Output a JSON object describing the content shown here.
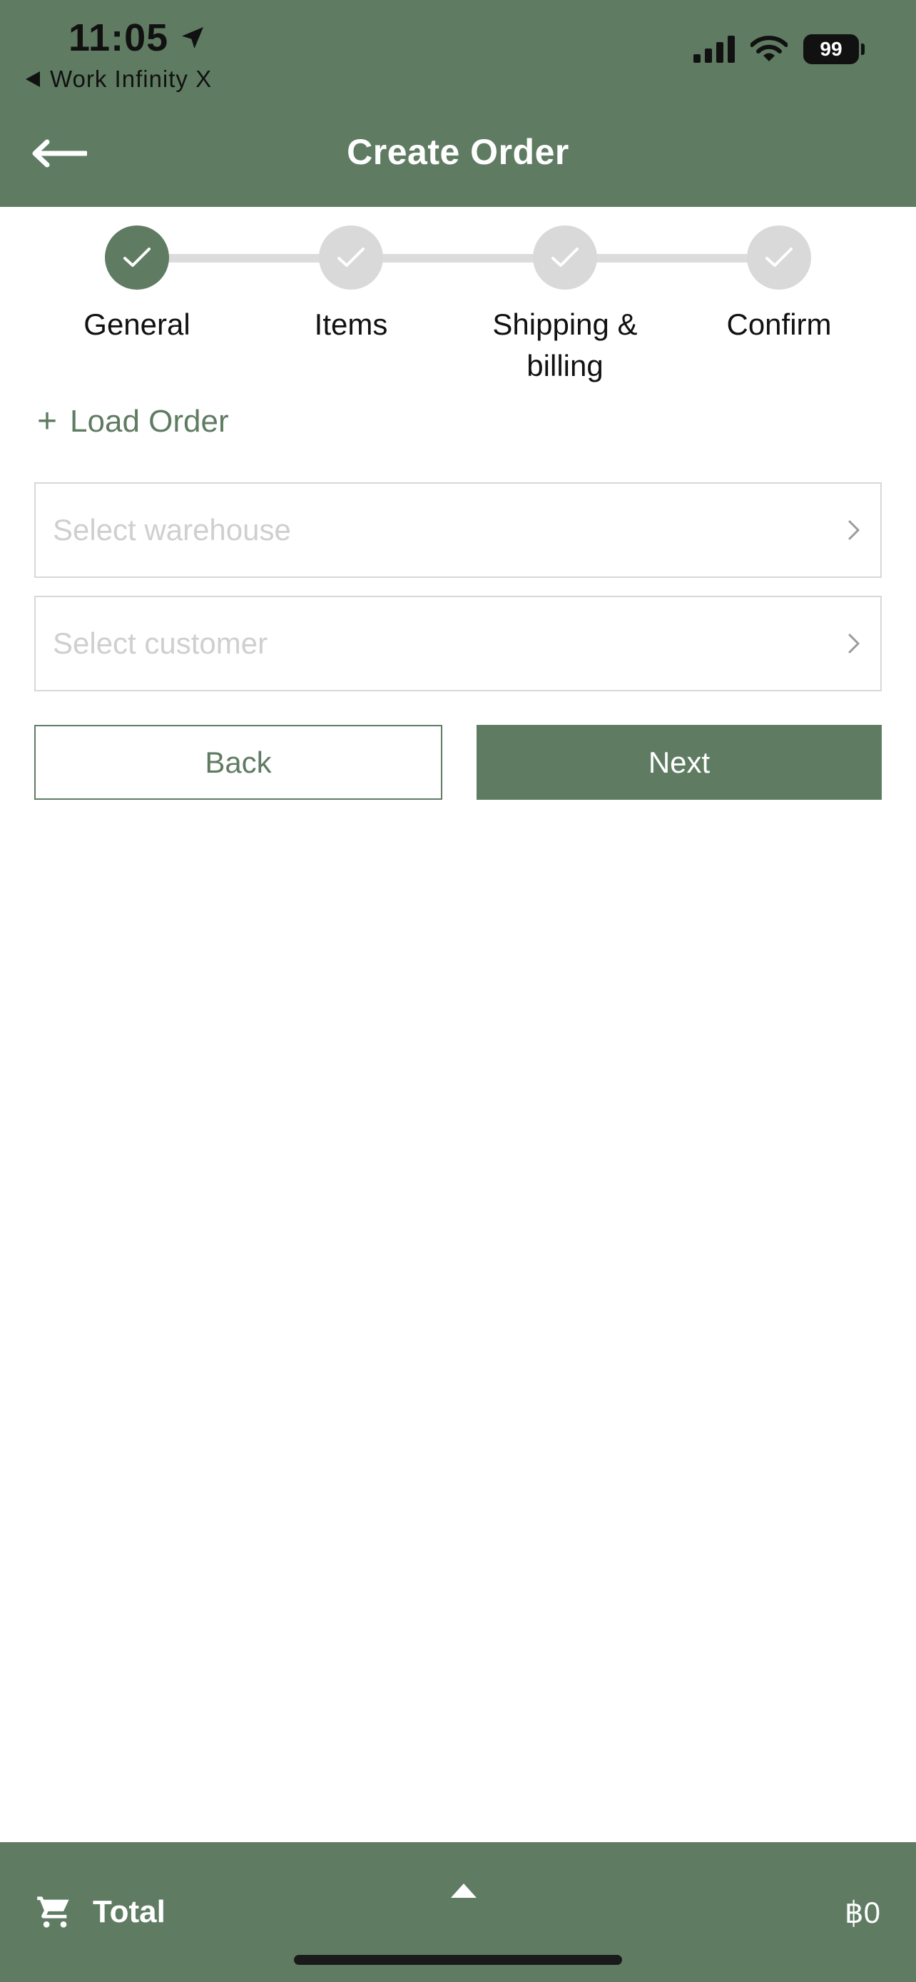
{
  "status_bar": {
    "time": "11:05",
    "back_app_label": "Work Infinity X",
    "battery": "99"
  },
  "nav": {
    "title": "Create Order"
  },
  "stepper": {
    "steps": [
      {
        "label": "General",
        "state": "active"
      },
      {
        "label": "Items",
        "state": "inactive"
      },
      {
        "label": "Shipping & billing",
        "state": "inactive"
      },
      {
        "label": "Confirm",
        "state": "inactive"
      }
    ]
  },
  "form": {
    "load_order": "Load Order",
    "warehouse_placeholder": "Select warehouse",
    "customer_placeholder": "Select customer"
  },
  "actions": {
    "back": "Back",
    "next": "Next"
  },
  "footer": {
    "total_label": "Total",
    "amount": "฿0"
  },
  "colors": {
    "primary": "#5f7c63",
    "inactive_step": "#d9d9d9",
    "placeholder": "#cfcfcf"
  }
}
